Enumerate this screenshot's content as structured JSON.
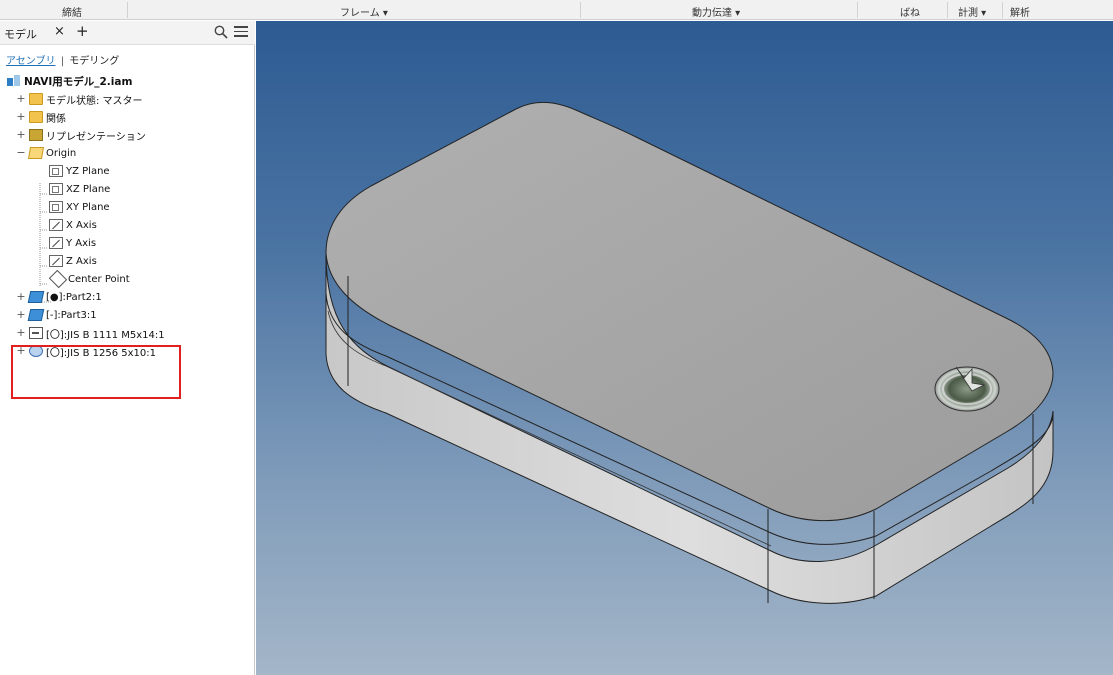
{
  "ribbon": {
    "panels": [
      "締結",
      "フレーム ▾",
      "動力伝達 ▾",
      "ばね",
      "計測 ▾",
      "解析"
    ]
  },
  "browser": {
    "tab_title": "モデル",
    "close_glyph": "×",
    "add_glyph": "+",
    "subtabs": {
      "assembly": "アセンブリ",
      "separator": "|",
      "modeling": "モデリング"
    },
    "tree": [
      {
        "label": "NAVI用モデル_2.iam",
        "icon": "assembly-icon",
        "expander": ""
      },
      {
        "label": "モデル状態: マスター",
        "icon": "folder-icon",
        "expander": "+"
      },
      {
        "label": "関係",
        "icon": "folder-icon",
        "expander": "+"
      },
      {
        "label": "リプレゼンテーション",
        "icon": "representation-icon",
        "expander": "+"
      },
      {
        "label": "Origin",
        "icon": "folder-open-icon",
        "expander": "−"
      },
      {
        "label": "YZ Plane",
        "icon": "plane-icon",
        "expander": ""
      },
      {
        "label": "XZ Plane",
        "icon": "plane-icon",
        "expander": ""
      },
      {
        "label": "XY Plane",
        "icon": "plane-icon",
        "expander": ""
      },
      {
        "label": "X Axis",
        "icon": "axis-icon",
        "expander": ""
      },
      {
        "label": "Y Axis",
        "icon": "axis-icon",
        "expander": ""
      },
      {
        "label": "Z Axis",
        "icon": "axis-icon",
        "expander": ""
      },
      {
        "label": "Center Point",
        "icon": "center-point-icon",
        "expander": ""
      },
      {
        "label": "[●]:Part2:1",
        "icon": "part-icon",
        "expander": "+"
      },
      {
        "label": "[-]:Part3:1",
        "icon": "part-icon",
        "expander": "+"
      },
      {
        "label": "[〇]:JIS B 1111 M5x14:1",
        "icon": "bolt-icon",
        "expander": "+"
      },
      {
        "label": "[〇]:JIS B 1256 5x10:1",
        "icon": "washer-icon",
        "expander": "+"
      }
    ]
  },
  "colors": {
    "highlight": "#e02020",
    "viewport_top": "#2d5b92",
    "viewport_bottom": "#a4b6c8",
    "part_top": "#a6a6a6",
    "part_side": "#d4d4d4"
  }
}
